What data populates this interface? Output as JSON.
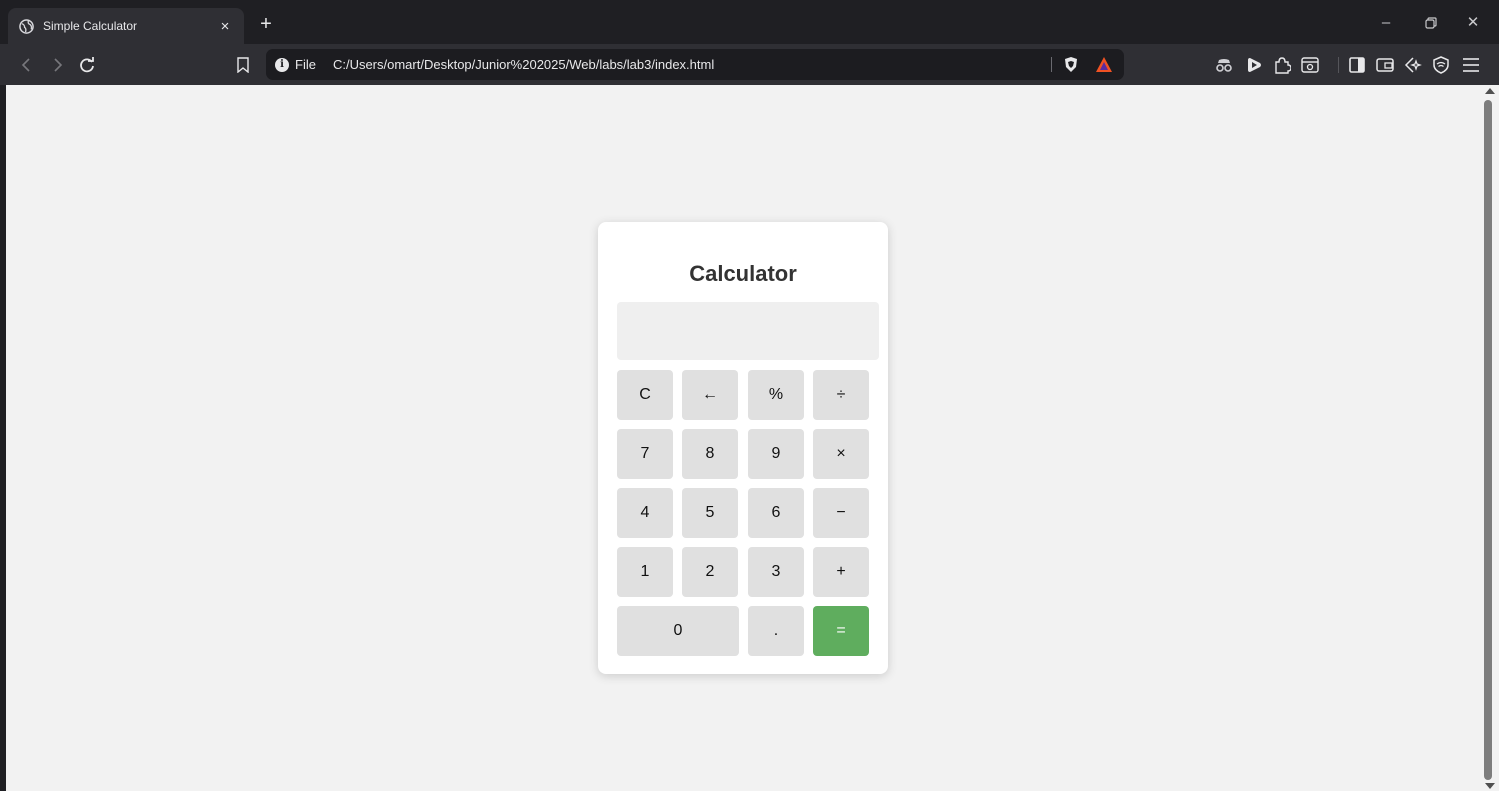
{
  "browser": {
    "tab_title": "Simple Calculator",
    "tab_close": "×",
    "new_tab": "+",
    "window_minimize": "–",
    "window_restore": "❐",
    "window_close": "✕",
    "address_scheme": "File",
    "address_url": "C:/Users/omart/Desktop/Junior%202025/Web/labs/lab3/index.html",
    "address_info_glyph": "i"
  },
  "calculator": {
    "title": "Calculator",
    "display_value": "",
    "keys": {
      "clear": "C",
      "backspace": "←",
      "percent": "%",
      "divide": "÷",
      "seven": "7",
      "eight": "8",
      "nine": "9",
      "multiply": "×",
      "four": "4",
      "five": "5",
      "six": "6",
      "subtract": "−",
      "one": "1",
      "two": "2",
      "three": "3",
      "add": "+",
      "zero": "0",
      "decimal": ".",
      "equals": "="
    }
  },
  "colors": {
    "equals_key": "#5fad5e",
    "key_bg": "#e0e0e0",
    "page_bg": "#f2f2f2",
    "brave_orange": "#f05223"
  },
  "icons": {
    "tab_favicon": "globe-icon",
    "back": "back-arrow-icon",
    "forward": "forward-arrow-icon",
    "reload": "reload-icon",
    "bookmark": "bookmark-icon",
    "shields": "brave-shields-icon",
    "rewards": "brave-rewards-icon",
    "toolbar": [
      "incognito-glasses-icon",
      "play-icon",
      "extensions-puzzle-icon",
      "screenshot-icon",
      "sidebar-icon",
      "wallet-icon",
      "leo-ai-icon",
      "vpn-icon",
      "menu-icon"
    ]
  }
}
